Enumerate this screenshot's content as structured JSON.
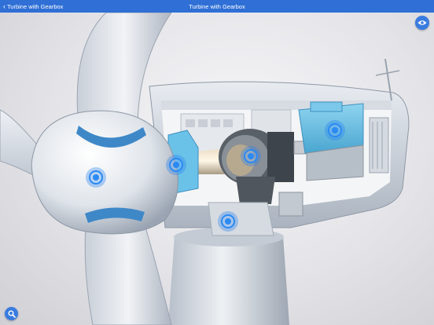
{
  "topbar": {
    "back_label": "Turbine with Gearbox",
    "title": "Turbine with Gearbox"
  },
  "icons": {
    "back": "chevron-left-icon",
    "view": "eye-icon",
    "zoom": "search-icon"
  },
  "hotspots": [
    {
      "id": "hub"
    },
    {
      "id": "main-bearing"
    },
    {
      "id": "gearbox"
    },
    {
      "id": "generator"
    },
    {
      "id": "yaw-system"
    }
  ],
  "colors": {
    "accent": "#2f6fd6",
    "hotspot": "#2b8af2",
    "component_blue": "#6bc2e8"
  }
}
